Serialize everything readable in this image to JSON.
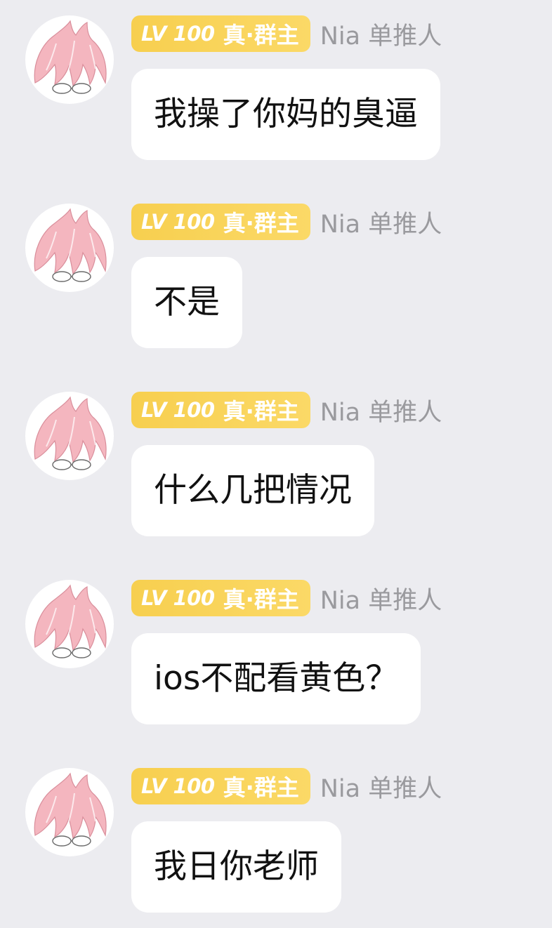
{
  "messages": [
    {
      "badge_level": "LV 100",
      "badge_title": "真·群主",
      "sender": "Nia 单推人",
      "text": "我操了你妈的臭逼"
    },
    {
      "badge_level": "LV 100",
      "badge_title": "真·群主",
      "sender": "Nia 单推人",
      "text": "不是"
    },
    {
      "badge_level": "LV 100",
      "badge_title": "真·群主",
      "sender": "Nia 单推人",
      "text": "什么几把情况"
    },
    {
      "badge_level": "LV 100",
      "badge_title": "真·群主",
      "sender": "Nia 单推人",
      "text": "ios不配看黄色？"
    },
    {
      "badge_level": "LV 100",
      "badge_title": "真·群主",
      "sender": "Nia 单推人",
      "text": "我日你老师"
    }
  ],
  "colors": {
    "background": "#ececf0",
    "bubble": "#ffffff",
    "badge": "#f7cf4f",
    "nickname": "#9a9a9e",
    "avatar_hair": "#f4b6bf"
  },
  "icons": {
    "avatar": "pink-haired-anime-avatar"
  }
}
